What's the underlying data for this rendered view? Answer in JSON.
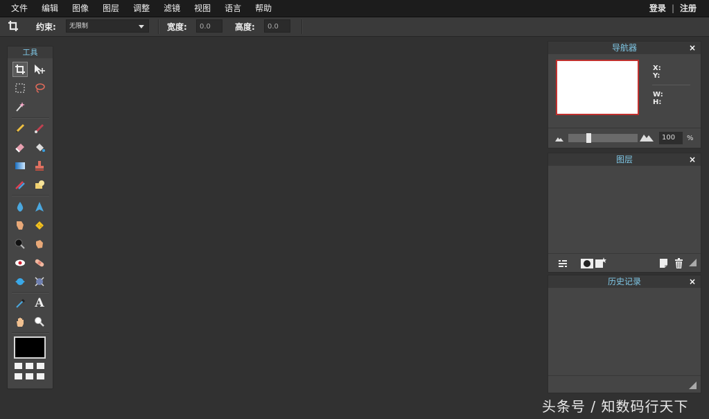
{
  "menu": {
    "items": [
      "文件",
      "编辑",
      "图像",
      "图层",
      "调整",
      "滤镜",
      "视图",
      "语言",
      "帮助"
    ],
    "login": "登录",
    "separator": "|",
    "register": "注册"
  },
  "options": {
    "constraint_label": "约束:",
    "constraint_value": "无限制",
    "width_label": "宽度:",
    "width_value": "0.0",
    "height_label": "高度:",
    "height_value": "0.0"
  },
  "tools": {
    "title": "工具",
    "items": [
      "crop-tool",
      "move-tool",
      "marquee-tool",
      "lasso-tool",
      "magic-wand-tool",
      "pencil-tool",
      "brush-tool",
      "eraser-tool",
      "paint-bucket-tool",
      "gradient-tool",
      "clone-stamp-tool",
      "color-replace-tool",
      "spot-heal-tool",
      "blur-tool",
      "sharpen-tool",
      "smudge-tool",
      "sponge-tool",
      "burn-tool",
      "dodge-tool",
      "red-eye-tool",
      "bloat-tool",
      "pinch-tool",
      "drawing-tool",
      "color-picker-tool",
      "type-tool",
      "hand-tool",
      "zoom-tool"
    ],
    "type_glyph": "A",
    "foreground_color": "#000000"
  },
  "navigator": {
    "title": "导航器",
    "close": "×",
    "x_label": "X:",
    "y_label": "Y:",
    "w_label": "W:",
    "h_label": "H:",
    "zoom_value": "100",
    "zoom_unit": "%",
    "zoom_slider_fraction": 0.28
  },
  "layers": {
    "title": "图层",
    "close": "×"
  },
  "history": {
    "title": "历史记录",
    "close": "×"
  },
  "watermark": "头条号 / 知数码行天下",
  "colors": {
    "accent_title": "#7fc7e6",
    "nav_frame": "#c0302e"
  }
}
